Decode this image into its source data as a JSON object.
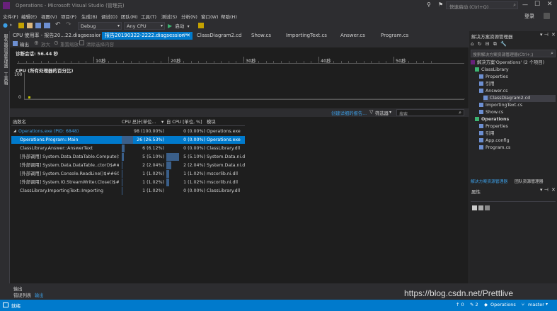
{
  "window": {
    "title": "Operations - Microsoft Visual Studio (管理员)",
    "quick_launch": "快速启动 (Ctrl+Q)",
    "login": "登录"
  },
  "menu": [
    "文件(F)",
    "编辑(E)",
    "视图(V)",
    "项目(P)",
    "生成(B)",
    "调试(D)",
    "团队(M)",
    "工具(T)",
    "测试(S)",
    "分析(N)",
    "窗口(W)",
    "帮助(H)"
  ],
  "toolbar": {
    "config": "Debug",
    "platform": "Any CPU",
    "start": "启动"
  },
  "tabs": [
    {
      "label": "CPU 使用率 - 报告20...22.diagsession"
    },
    {
      "label": "报告20190322-2222.diagsession*",
      "active": true
    },
    {
      "label": "ClassDiagram2.cd"
    },
    {
      "label": "Show.cs"
    },
    {
      "label": "ImportingText.cs"
    },
    {
      "label": "Answer.cs"
    },
    {
      "label": "Program.cs"
    }
  ],
  "left_strip": {
    "top": "服务器资源管理器",
    "bottom": "工具箱"
  },
  "diag": {
    "output_btn": "输出",
    "zoom_in": "放大",
    "reset_zoom": "重置缩放",
    "clear_selection": "清除选择内容",
    "session_label": "诊断会话: 56.44 秒",
    "timeline_ticks": [
      "10秒",
      "20秒",
      "30秒",
      "40秒",
      "50秒"
    ],
    "cpu_label": "CPU (所有处理器的百分比)",
    "y_max": "100",
    "y_min": "0",
    "create_report": "创建详细的报告...",
    "filter": "筛选器",
    "search_placeholder": "搜索"
  },
  "table": {
    "headers": [
      "函数名",
      "CPU 总计[单位...",
      "自 CPU [单位, %]",
      "模块"
    ],
    "rows": [
      {
        "name": "Operations.exe (PID: 6848)",
        "total": "98 (100.00%)",
        "self": "0 (0.00%)",
        "module": "Operations.exe",
        "total_pct": 1.0,
        "self_pct": 0.0,
        "root": true
      },
      {
        "name": "Operations.Program::Main",
        "total": "26 (26.53%)",
        "self": "0 (0.00%)",
        "module": "Operations.exe",
        "total_pct": 0.2653,
        "self_pct": 0.0,
        "selected": true
      },
      {
        "name": "ClassLibrary.Answer::AnswerText",
        "total": "6 (6.12%)",
        "self": "0 (0.00%)",
        "module": "ClassLibrary.dll",
        "total_pct": 0.0612,
        "self_pct": 0.0
      },
      {
        "name": "[外部调用] System.Data.DataTable.Compute(S...",
        "total": "5 (5.10%)",
        "self": "5 (5.10%)",
        "module": "System.Data.ni.dll",
        "total_pct": 0.051,
        "self_pct": 0.051
      },
      {
        "name": "[外部调用] System.Data.DataTable..ctor()$##6...",
        "total": "2 (2.04%)",
        "self": "2 (2.04%)",
        "module": "System.Data.ni.dll",
        "total_pct": 0.0204,
        "self_pct": 0.0204
      },
      {
        "name": "[外部调用] System.Console.ReadLine()$##600...",
        "total": "1 (1.02%)",
        "self": "1 (1.02%)",
        "module": "mscorlib.ni.dll",
        "total_pct": 0.0102,
        "self_pct": 0.0102
      },
      {
        "name": "[外部调用] System.IO.StreamWriter.Close()$#...",
        "total": "1 (1.02%)",
        "self": "1 (1.02%)",
        "module": "mscorlib.ni.dll",
        "total_pct": 0.0102,
        "self_pct": 0.0102
      },
      {
        "name": "ClassLibrary.ImportingText::Importing",
        "total": "1 (1.02%)",
        "self": "0 (0.00%)",
        "module": "ClassLibrary.dll",
        "total_pct": 0.0102,
        "self_pct": 0.0
      }
    ]
  },
  "solution": {
    "title": "解决方案资源管理器",
    "search_placeholder": "搜索解决方案资源管理器(Ctrl+;)",
    "items": [
      {
        "label": "解决方案'Operations' (2 个项目)",
        "indent": 0
      },
      {
        "label": "ClassLibrary",
        "indent": 1
      },
      {
        "label": "Properties",
        "indent": 2
      },
      {
        "label": "引用",
        "indent": 2
      },
      {
        "label": "Answer.cs",
        "indent": 2
      },
      {
        "label": "ClassDiagram2.cd",
        "indent": 3,
        "selected": true
      },
      {
        "label": "ImportingText.cs",
        "indent": 2
      },
      {
        "label": "Show.cs",
        "indent": 2
      },
      {
        "label": "Operations",
        "indent": 1,
        "bold": true
      },
      {
        "label": "Properties",
        "indent": 2
      },
      {
        "label": "引用",
        "indent": 2
      },
      {
        "label": "App.config",
        "indent": 2
      },
      {
        "label": "Program.cs",
        "indent": 2
      }
    ],
    "tab_solution": "解决方案资源管理器",
    "tab_team": "团队资源管理器",
    "properties_title": "属性"
  },
  "output": {
    "title": "输出",
    "tab_errors": "错误列表",
    "tab_output": "输出"
  },
  "status": {
    "ready": "就绪",
    "project": "Operations",
    "branch": "master"
  },
  "watermark": "https://blog.csdn.net/Prettlive",
  "colors": {
    "accent": "#007acc",
    "bg": "#2d2d30",
    "editor": "#1e1e1e",
    "vs_purple": "#68217a"
  }
}
